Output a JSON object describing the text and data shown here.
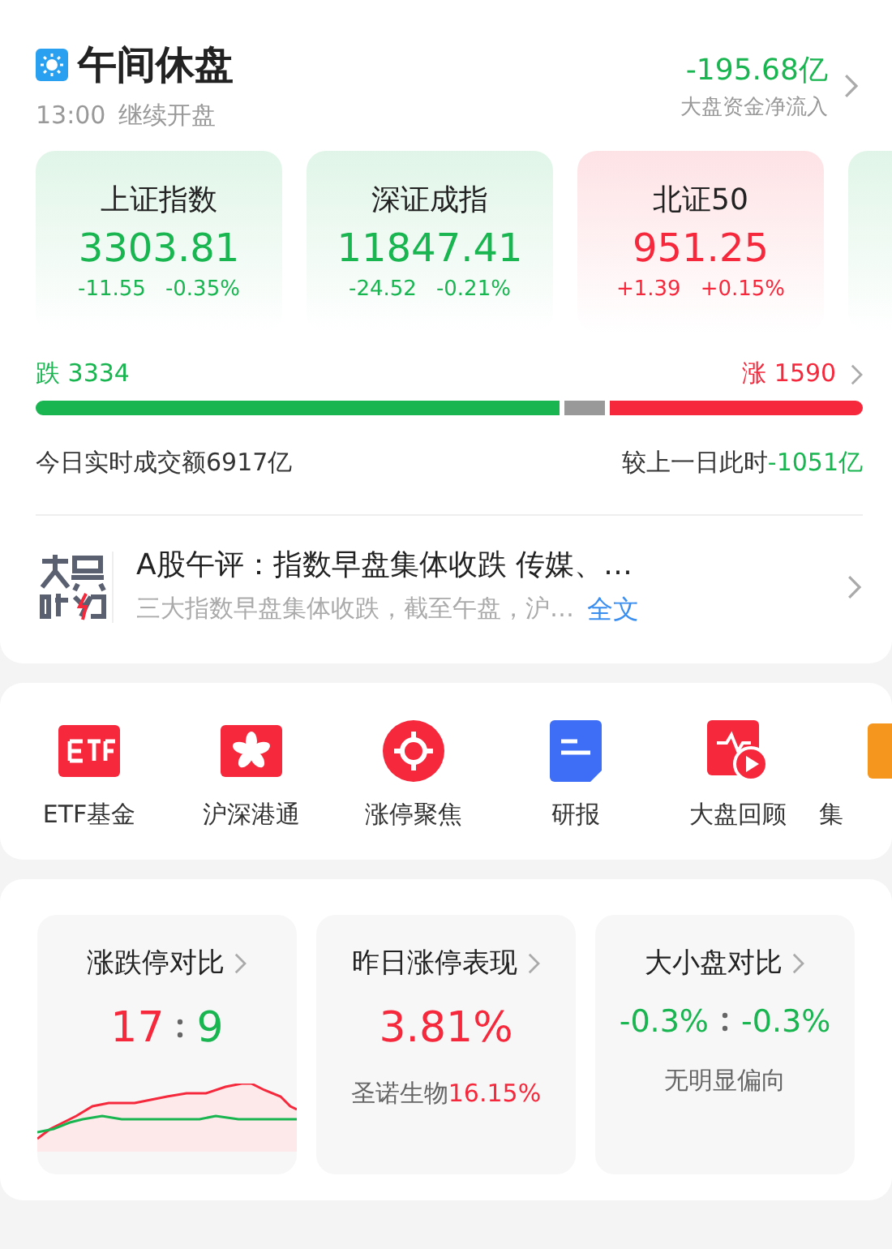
{
  "header": {
    "title": "午间休盘",
    "time": "13:00",
    "subtitle": "继续开盘",
    "flow_value": "-195.68亿",
    "flow_label": "大盘资金净流入"
  },
  "indices": [
    {
      "name": "上证指数",
      "value": "3303.81",
      "change": "-11.55",
      "percent": "-0.35%",
      "color": "#18b550"
    },
    {
      "name": "深证成指",
      "value": "11847.41",
      "change": "-24.52",
      "percent": "-0.21%",
      "color": "#18b550"
    },
    {
      "name": "北证50",
      "value": "951.25",
      "change": "+1.39",
      "percent": "+0.15%",
      "color": "#f5283c"
    }
  ],
  "breadth": {
    "fall_label": "跌",
    "fall_count": "3334",
    "rise_label": "涨",
    "rise_count": "1590",
    "turnover": "今日实时成交额6917亿",
    "compare_label": "较上一日此时",
    "compare_value": "-1051亿"
  },
  "commentary": {
    "title": "A股午评：指数早盘集体收跌 传媒、…",
    "summary": "三大指数早盘集体收跌，截至午盘，沪…",
    "link": "全文"
  },
  "shortcuts": [
    {
      "kind": "etf",
      "label": "ETF基金"
    },
    {
      "kind": "hk",
      "label": "沪深港通"
    },
    {
      "kind": "target",
      "label": "涨停聚焦"
    },
    {
      "kind": "report",
      "label": "研报"
    },
    {
      "kind": "review",
      "label": "大盘回顾"
    },
    {
      "kind": "collect",
      "label": "集"
    }
  ],
  "stats": [
    {
      "kind": "ratio",
      "title": "涨跌停对比",
      "left": {
        "text": "17",
        "color": "#f5283c"
      },
      "right": {
        "text": "9",
        "color": "#18b550"
      }
    },
    {
      "kind": "single",
      "title": "昨日涨停表现",
      "value": {
        "text": "3.81%",
        "color": "#f5283c"
      },
      "note": "圣诺生物",
      "note_value": {
        "text": "16.15%",
        "color": "#f5283c"
      }
    },
    {
      "kind": "ratio",
      "title": "大小盘对比",
      "left": {
        "text": "-0.3%",
        "color": "#18b550"
      },
      "right": {
        "text": "-0.3%",
        "color": "#18b550"
      },
      "note": "无明显偏向"
    }
  ]
}
